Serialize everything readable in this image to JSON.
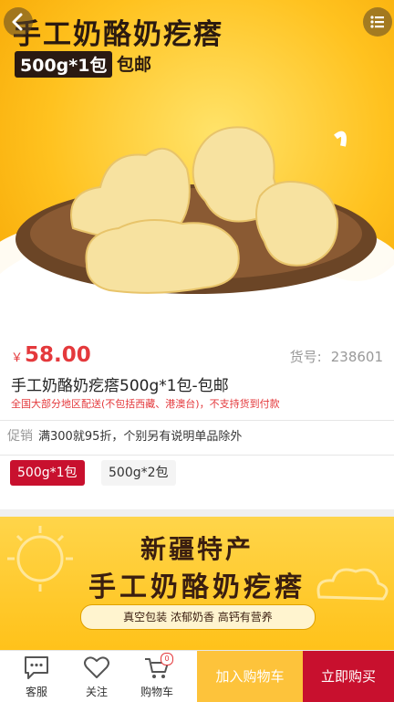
{
  "hero": {
    "title": "手工奶酪奶疙瘩",
    "weight_tag": "500g*1包",
    "shipping_tag": "包邮"
  },
  "nav": {
    "back_icon": "back-arrow-icon",
    "menu_icon": "list-menu-icon"
  },
  "product": {
    "currency": "￥",
    "price": "58.00",
    "sku_label": "货号:",
    "sku_value": "238601",
    "title": "手工奶酪奶疙瘩500g*1包-包邮",
    "shipping_note": "全国大部分地区配送(不包括西藏、港澳台)，不支持货到付款"
  },
  "promotion": {
    "tag": "促销",
    "text": "满300就95折，个别另有说明单品除外"
  },
  "options": [
    {
      "label": "500g*1包",
      "selected": true
    },
    {
      "label": "500g*2包",
      "selected": false
    }
  ],
  "banner": {
    "line1": "新疆特产",
    "line2": "手工奶酪奶疙瘩",
    "tagline": "真空包装 浓郁奶香 高钙有营养"
  },
  "bottom_bar": {
    "service_label": "客服",
    "follow_label": "关注",
    "cart_label": "购物车",
    "cart_count": "0",
    "add_to_cart": "加入购物车",
    "buy_now": "立即购买"
  },
  "colors": {
    "accent_red": "#c8102e",
    "price_red": "#e4393c",
    "cart_yellow": "#fdc33b"
  }
}
